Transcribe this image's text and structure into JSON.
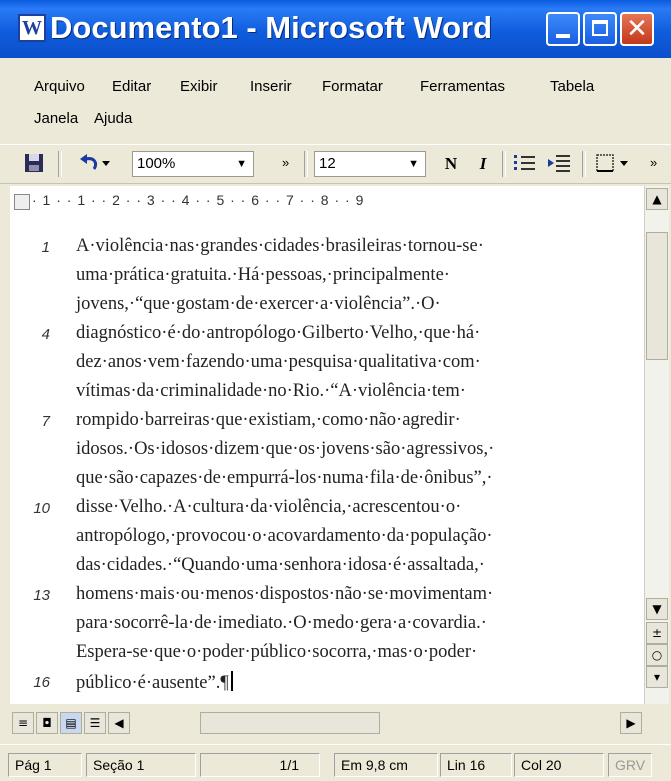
{
  "window": {
    "title": "Documento1 - Microsoft Word",
    "icon": "W"
  },
  "menubar": {
    "items": [
      "Arquivo",
      "Editar",
      "Exibir",
      "Inserir",
      "Formatar",
      "Ferramentas",
      "Tabela",
      "Janela",
      "Ajuda"
    ]
  },
  "toolbar": {
    "zoom": "100%",
    "font_size": "12",
    "bold": "N",
    "italic": "I",
    "more": "»"
  },
  "ruler": {
    "text": "· 1 · · 1 · · 2 · · 3 · · 4 · · 5 · · 6 · · 7 · · 8 · · 9"
  },
  "document": {
    "lines": [
      {
        "num": "1",
        "text": "A·violência·nas·grandes·cidades·brasileiras·tornou-se·"
      },
      {
        "num": "",
        "text": "uma·prática·gratuita.·Há·pessoas,·principalmente·"
      },
      {
        "num": "",
        "text": "jovens,·“que·gostam·de·exercer·a·violência”.·O·"
      },
      {
        "num": "4",
        "text": "diagnóstico·é·do·antropólogo·Gilberto·Velho,·que·há·"
      },
      {
        "num": "",
        "text": "dez·anos·vem·fazendo·uma·pesquisa·qualitativa·com·"
      },
      {
        "num": "",
        "text": "vítimas·da·criminalidade·no·Rio.·“A·violência·tem·"
      },
      {
        "num": "7",
        "text": "rompido·barreiras·que·existiam,·como·não·agredir·"
      },
      {
        "num": "",
        "text": "idosos.·Os·idosos·dizem·que·os·jovens·são·agressivos,·"
      },
      {
        "num": "",
        "text": "que·são·capazes·de·empurrá-los·numa·fila·de·ônibus”,·"
      },
      {
        "num": "10",
        "text": "disse·Velho.·A·cultura·da·violência,·acrescentou·o·"
      },
      {
        "num": "",
        "text": "antropólogo,·provocou·o·acovardamento·da·população·"
      },
      {
        "num": "",
        "text": "das·cidades.·“Quando·uma·senhora·idosa·é·assaltada,·"
      },
      {
        "num": "13",
        "text": "homens·mais·ou·menos·dispostos·não·se·movimentam·"
      },
      {
        "num": "",
        "text": "para·socorrê-la·de·imediato.·O·medo·gera·a·covardia.·"
      },
      {
        "num": "",
        "text": "Espera-se·que·o·poder·público·socorra,·mas·o·poder·"
      },
      {
        "num": "16",
        "text": "público·é·ausente”.¶"
      }
    ]
  },
  "statusbar": {
    "page": "Pág 1",
    "section": "Seção 1",
    "pages": "1/1",
    "position": "Em 9,8 cm",
    "line": "Lin 16",
    "column": "Col 20",
    "rec": "GRV"
  }
}
